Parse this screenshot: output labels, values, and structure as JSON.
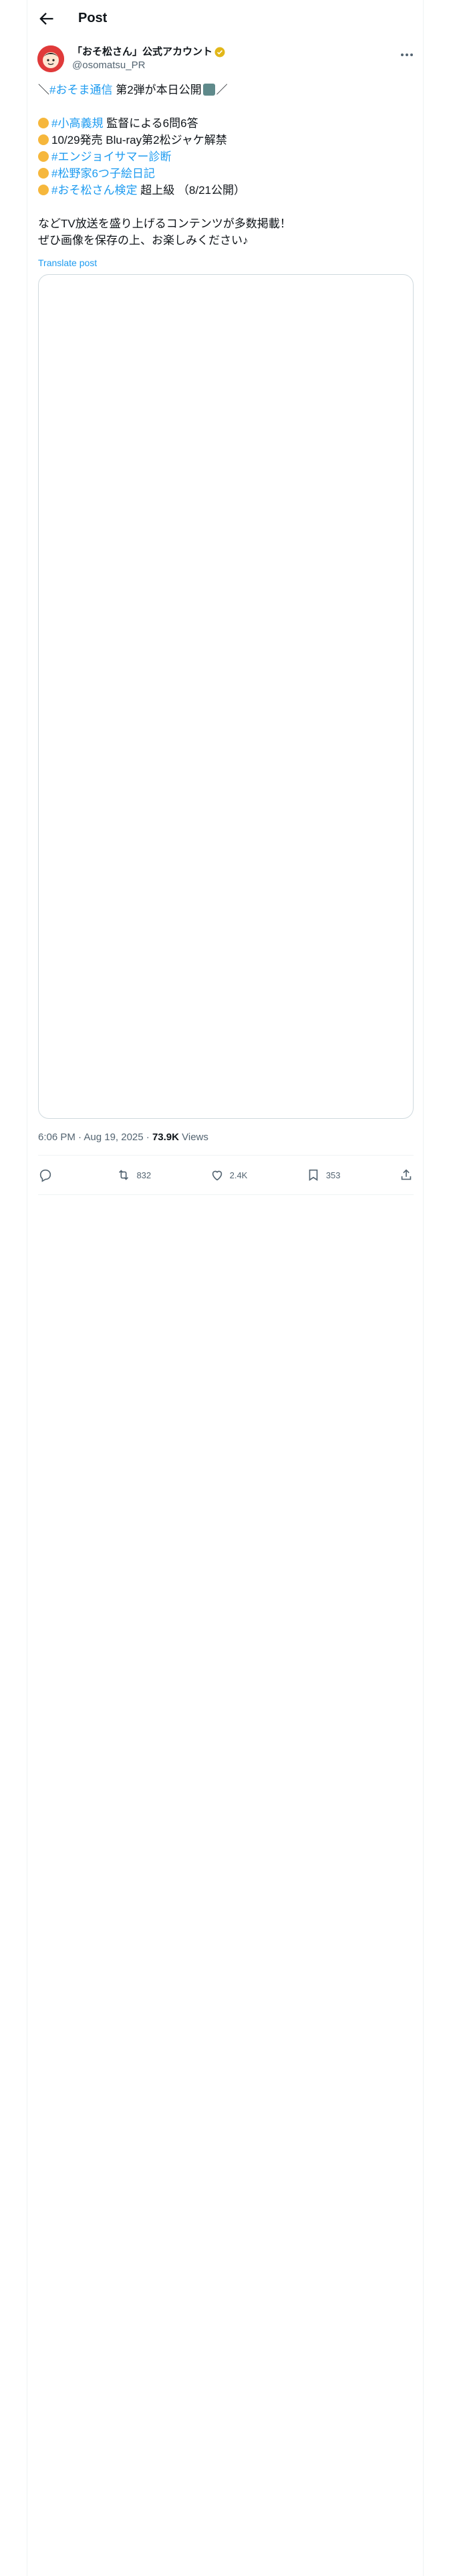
{
  "header": {
    "title": "Post"
  },
  "author": {
    "display_name": "「おそ松さん」公式アカウント",
    "handle": "@osomatsu_PR"
  },
  "tweet": {
    "line1_prefix": "＼",
    "line1_tag": "#おそま通信",
    "line1_text": " 第2弾が本日公開",
    "line1_suffix": "／",
    "bullets": [
      {
        "tag": "#小高義規",
        "text": " 監督による6問6答"
      },
      {
        "tag": "",
        "text": "10/29発売 Blu-ray第2松ジャケ解禁"
      },
      {
        "tag": "#エンジョイサマー診断",
        "text": ""
      },
      {
        "tag": "#松野家6つ子絵日記",
        "text": ""
      },
      {
        "tag": "#おそ松さん検定",
        "text": " 超上級 （8/21公開）"
      }
    ],
    "closing1": "などTV放送を盛り上げるコンテンツが多数掲載！",
    "closing2": "ぜひ画像を保存の上、お楽しみください♪"
  },
  "translate_label": "Translate post",
  "meta": {
    "time": "6:06 PM · Aug 19, 2025 · ",
    "views_count": "73.9K",
    "views_label": " Views"
  },
  "actions": {
    "reply": "",
    "retweets": "832",
    "likes": "2.4K",
    "bookmarks": "353"
  },
  "colors": {
    "accent": "#1d9bf0",
    "secondary_text": "#536471",
    "border": "#cfd9de"
  }
}
